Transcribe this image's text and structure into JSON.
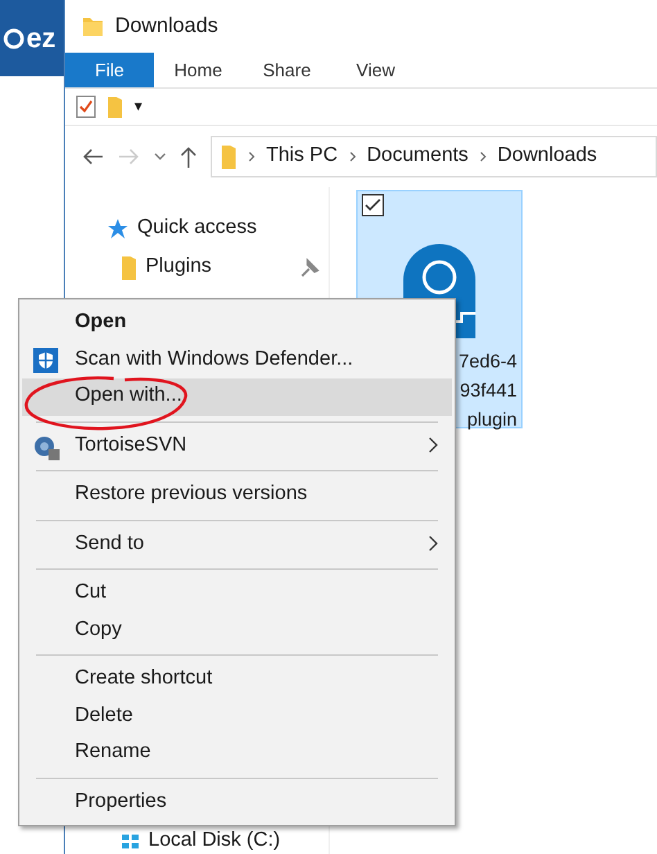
{
  "desktop": {
    "logo_text": "ez"
  },
  "window": {
    "title": "Downloads"
  },
  "ribbon_tabs": [
    {
      "label": "File",
      "selected": true
    },
    {
      "label": "Home",
      "selected": false
    },
    {
      "label": "Share",
      "selected": false
    },
    {
      "label": "View",
      "selected": false
    }
  ],
  "quick_access_toolbar": {
    "dropdown": "▾"
  },
  "address_bar": {
    "path": [
      "This PC",
      "Documents",
      "Downloads"
    ]
  },
  "navigation_pane": {
    "items": [
      {
        "label": "Quick access",
        "kind": "quick-access"
      },
      {
        "label": "Plugins",
        "kind": "pinned-folder"
      },
      {
        "label": "Local Disk (C:)",
        "kind": "drive"
      }
    ]
  },
  "file_tile": {
    "selected": true,
    "checked": true,
    "name_lines": [
      "7ed6-4",
      "93f441",
      "plugin"
    ]
  },
  "context_menu": {
    "items": [
      {
        "kind": "default",
        "label": "Open",
        "selected": false
      },
      {
        "kind": "scan",
        "label": "Scan with Windows Defender...",
        "selected": false
      },
      {
        "kind": "command",
        "label": "Open with...",
        "selected": true
      },
      {
        "kind": "separator"
      },
      {
        "kind": "versioning",
        "label": "TortoiseSVN",
        "selected": false
      },
      {
        "kind": "separator"
      },
      {
        "kind": "command",
        "label": "Restore previous versions",
        "selected": false
      },
      {
        "kind": "separator"
      },
      {
        "kind": "submenu",
        "label": "Send to",
        "selected": false
      },
      {
        "kind": "separator"
      },
      {
        "kind": "command",
        "label": "Cut",
        "selected": false
      },
      {
        "kind": "command",
        "label": "Copy",
        "selected": false
      },
      {
        "kind": "separator"
      },
      {
        "kind": "command",
        "label": "Create shortcut",
        "selected": false
      },
      {
        "kind": "command",
        "label": "Delete",
        "selected": false
      },
      {
        "kind": "command",
        "label": "Rename",
        "selected": false
      },
      {
        "kind": "separator"
      },
      {
        "kind": "command",
        "label": "Properties",
        "selected": false
      }
    ]
  }
}
